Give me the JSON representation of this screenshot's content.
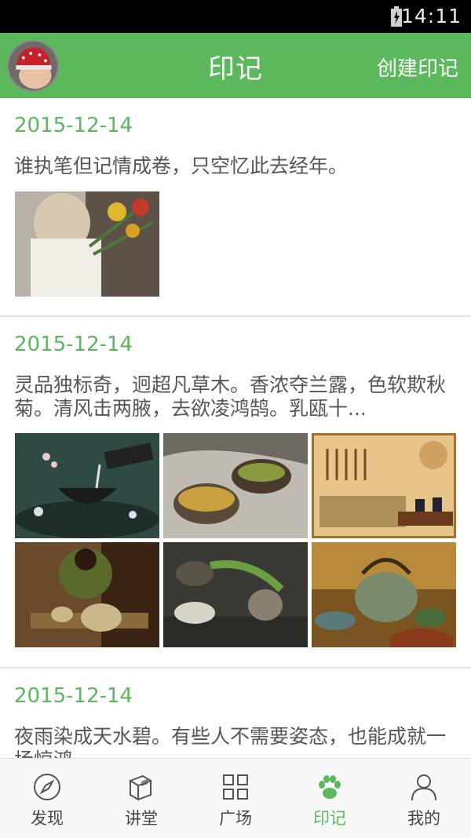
{
  "status_bar": {
    "time": "14:11",
    "icons": [
      "battery-charging-icon"
    ]
  },
  "header": {
    "title": "印记",
    "create_label": "创建印记"
  },
  "posts": [
    {
      "date": "2015-12-14",
      "text": "谁执笔但记情成卷，只空忆此去经年。",
      "image_count": 1
    },
    {
      "date": "2015-12-14",
      "text": "灵品独标奇，迥超凡草木。香浓夺兰露，色软欺秋菊。清风击两腋，去欲凌鸿鹄。乳瓯十...",
      "image_count": 6
    },
    {
      "date": "2015-12-14",
      "text": "夜雨染成天水碧。有些人不需要姿态，也能成就一场惊鸿"
    }
  ],
  "tabs": [
    {
      "label": "发现",
      "icon": "compass-icon",
      "active": false
    },
    {
      "label": "讲堂",
      "icon": "book-icon",
      "active": false
    },
    {
      "label": "广场",
      "icon": "grid-icon",
      "active": false
    },
    {
      "label": "印记",
      "icon": "paw-icon",
      "active": true
    },
    {
      "label": "我的",
      "icon": "person-icon",
      "active": false
    }
  ],
  "colors": {
    "accent": "#5cb85c",
    "status_bar": "#000000",
    "text": "#555555"
  }
}
